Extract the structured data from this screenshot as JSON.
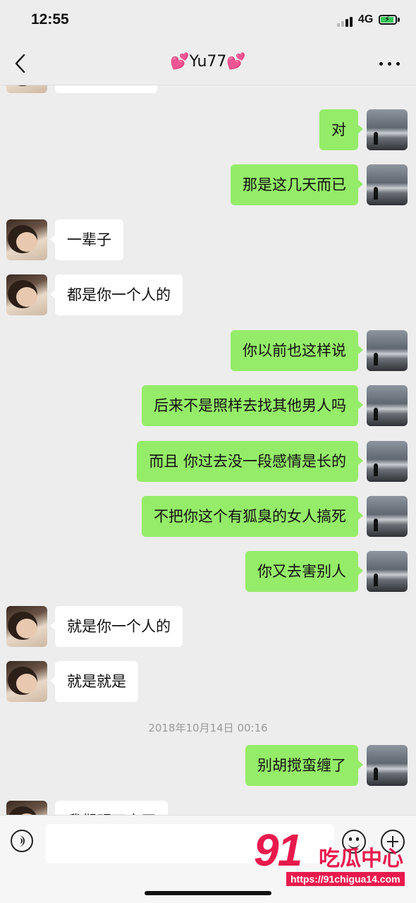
{
  "status_bar": {
    "time": "12:55",
    "network": "4G"
  },
  "header": {
    "title": "💕Yu77💕",
    "back_icon": "chevron-left-icon",
    "more_icon": "more-dots-icon"
  },
  "messages": [
    {
      "side": "other",
      "text": ""
    },
    {
      "side": "self",
      "text": "对"
    },
    {
      "side": "self",
      "text": "那是这几天而已"
    },
    {
      "side": "other",
      "text": "一辈子"
    },
    {
      "side": "other",
      "text": "都是你一个人的"
    },
    {
      "side": "self",
      "text": "你以前也这样说"
    },
    {
      "side": "self",
      "text": "后来不是照样去找其他男人吗"
    },
    {
      "side": "self",
      "text": "而且 你过去没一段感情是长的"
    },
    {
      "side": "self",
      "text": "不把你这个有狐臭的女人搞死"
    },
    {
      "side": "self",
      "text": "你又去害别人"
    },
    {
      "side": "other",
      "text": "就是你一个人的"
    },
    {
      "side": "other",
      "text": "就是就是"
    },
    {
      "side": "self",
      "text": "别胡搅蛮缠了"
    },
    {
      "side": "other",
      "text": "我们明天去买"
    }
  ],
  "timestamp": "2018年10月14日 00:16",
  "input_bar": {
    "voice_icon": "voice-icon",
    "text_value": "",
    "emoji_icon": "emoji-icon",
    "plus_icon": "plus-icon"
  },
  "watermark": {
    "number": "91",
    "name": "吃瓜中心",
    "url": "https://91chigua14.com"
  },
  "colors": {
    "self_bubble": "#95ec69",
    "other_bubble": "#ffffff",
    "background": "#ededed",
    "watermark": "#e8194d"
  }
}
